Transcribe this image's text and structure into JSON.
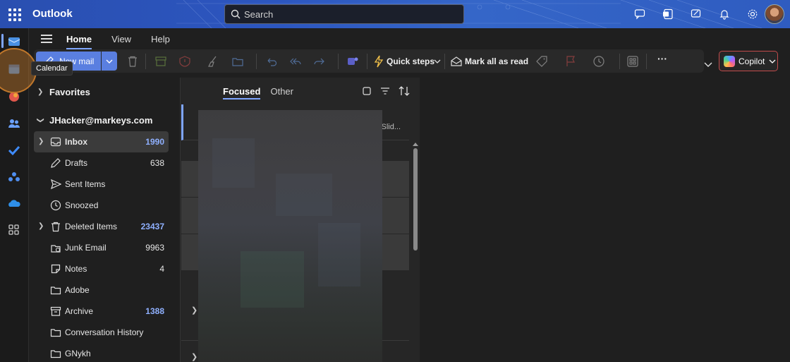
{
  "app": {
    "title": "Outlook"
  },
  "search": {
    "placeholder": "Search"
  },
  "topbar_icons": [
    "chat-icon",
    "office-icon",
    "whiteboard-icon",
    "bell-icon",
    "settings-icon"
  ],
  "rail": {
    "items": [
      "mail-icon",
      "calendar-icon",
      "copilot-icon",
      "people-icon",
      "todo-icon",
      "groups-icon",
      "onedrive-icon",
      "apps-icon"
    ],
    "tooltip": "Calendar"
  },
  "ribbon": {
    "tabs": [
      {
        "label": "Home",
        "active": true
      },
      {
        "label": "View",
        "active": false
      },
      {
        "label": "Help",
        "active": false
      }
    ]
  },
  "toolbar": {
    "new_mail": "New mail",
    "quick_steps": "Quick steps",
    "mark_all_read": "Mark all as read",
    "more": "···",
    "copilot": "Copilot"
  },
  "folders": {
    "favorites": "Favorites",
    "account": "JHacker@markeys.com",
    "items": [
      {
        "label": "Inbox",
        "count": "1990",
        "unread": true,
        "icon": "inbox-icon",
        "selected": true,
        "expandable": true
      },
      {
        "label": "Drafts",
        "count": "638",
        "unread": false,
        "icon": "pencil-icon"
      },
      {
        "label": "Sent Items",
        "count": "",
        "unread": false,
        "icon": "send-icon"
      },
      {
        "label": "Snoozed",
        "count": "",
        "unread": false,
        "icon": "clock-icon"
      },
      {
        "label": "Deleted Items",
        "count": "23437",
        "unread": true,
        "icon": "trash-icon",
        "expandable": true
      },
      {
        "label": "Junk Email",
        "count": "9963",
        "unread": false,
        "icon": "junk-icon"
      },
      {
        "label": "Notes",
        "count": "4",
        "unread": false,
        "icon": "note-icon"
      },
      {
        "label": "Adobe",
        "count": "",
        "unread": false,
        "icon": "folder-icon"
      },
      {
        "label": "Archive",
        "count": "1388",
        "unread": true,
        "icon": "archive-icon"
      },
      {
        "label": "Conversation History",
        "count": "",
        "unread": false,
        "icon": "folder-icon"
      },
      {
        "label": "GNykh",
        "count": "",
        "unread": false,
        "icon": "folder-icon"
      }
    ]
  },
  "message_list": {
    "tabs": [
      "Focused",
      "Other"
    ],
    "first_preview": "te: Slid..."
  },
  "colors": {
    "accent": "#7fa6ff",
    "primary_button": "#5a7fe0",
    "highlight": "#c0772b"
  }
}
